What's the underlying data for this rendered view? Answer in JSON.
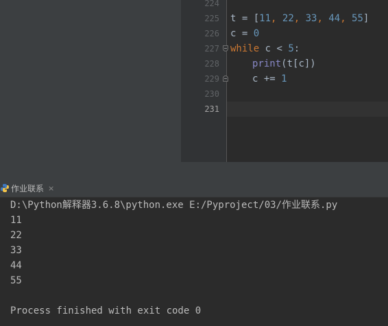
{
  "editor": {
    "line_numbers": [
      "224",
      "225",
      "226",
      "227",
      "228",
      "229",
      "230",
      "231"
    ],
    "code": {
      "l225": {
        "var": "t",
        "op": " = ",
        "open": "[",
        "n1": "11",
        "c1": ", ",
        "n2": "22",
        "c2": ", ",
        "n3": "33",
        "c3": ", ",
        "n4": "44",
        "c4": ", ",
        "n5": "55",
        "close": "]"
      },
      "l226": {
        "var": "c = ",
        "val": "0"
      },
      "l227": {
        "kw": "while",
        "cond": " c < ",
        "val": "5",
        "colon": ":"
      },
      "l228": {
        "fn": "print",
        "args": "(t[c])"
      },
      "l229": {
        "stmt": "c += ",
        "val": "1"
      }
    }
  },
  "run_panel": {
    "tab_label": "作业联系",
    "close_glyph": "×",
    "console_lines": [
      "D:\\Python解释器3.6.8\\python.exe E:/Pyproject/03/作业联系.py",
      "11",
      "22",
      "33",
      "44",
      "55",
      "",
      "Process finished with exit code 0"
    ]
  },
  "colors": {
    "background": "#2b2b2b",
    "keyword": "#cc7832",
    "number": "#6897bb",
    "builtin": "#8888c6",
    "text": "#a9b7c6"
  }
}
